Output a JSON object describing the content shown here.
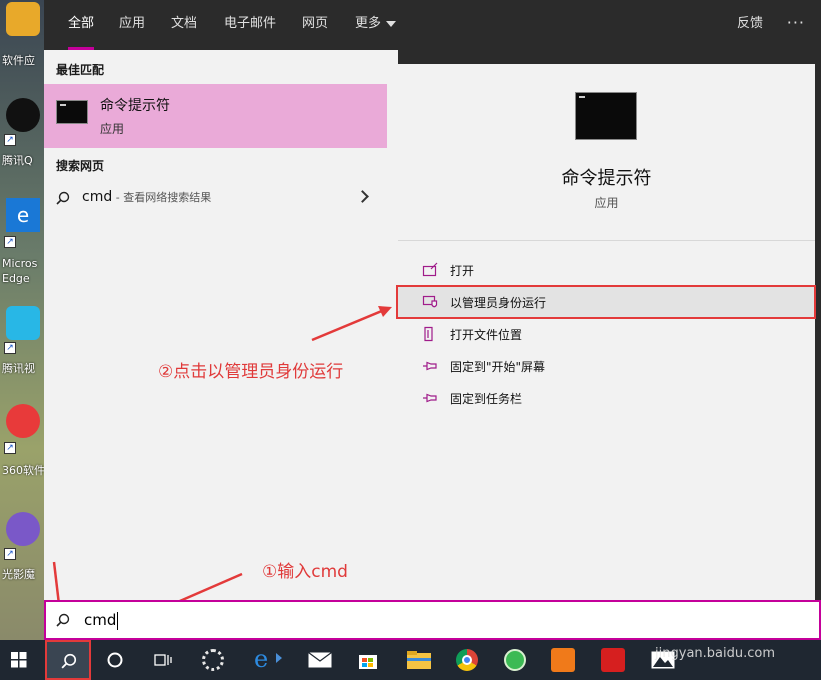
{
  "desktop": {
    "icons": [
      {
        "label": "软件应",
        "color": "#e8a92a"
      },
      {
        "label": "腾讯Q",
        "color": "#111111"
      },
      {
        "label": "Micros Edge",
        "color": "#1a78d6"
      },
      {
        "label": "腾讯视",
        "color": "#28b7e6"
      },
      {
        "label": "360软件",
        "color": "#e83a3a"
      },
      {
        "label": "光影魔",
        "color": "#7a58c8"
      }
    ]
  },
  "startmenu": {
    "tabs": [
      {
        "label": "全部",
        "active": true
      },
      {
        "label": "应用"
      },
      {
        "label": "文档"
      },
      {
        "label": "电子邮件"
      },
      {
        "label": "网页"
      },
      {
        "label": "更多"
      }
    ],
    "feedback_label": "反馈",
    "more_icon": "ellipsis-icon",
    "best_match_heading": "最佳匹配",
    "best_match": {
      "name": "命令提示符",
      "type": "应用"
    },
    "web_heading": "搜索网页",
    "web_result": {
      "query": "cmd",
      "desc": " - 查看网络搜索结果"
    },
    "preview": {
      "name": "命令提示符",
      "type": "应用",
      "actions": [
        {
          "label": "打开",
          "icon": "open-icon"
        },
        {
          "label": "以管理员身份运行",
          "icon": "shield-icon",
          "highlighted": true
        },
        {
          "label": "打开文件位置",
          "icon": "file-location-icon"
        },
        {
          "label": "固定到\"开始\"屏幕",
          "icon": "pin-icon"
        },
        {
          "label": "固定到任务栏",
          "icon": "pin-icon"
        }
      ]
    }
  },
  "annotations": {
    "step2": "②点击以管理员身份运行",
    "step1": "①输入cmd",
    "color": "#e33a3a"
  },
  "search": {
    "value": "cmd"
  },
  "watermark": "jingyan.baidu.com",
  "colors": {
    "accent": "#c4009a",
    "selected": "#eaaad8"
  }
}
